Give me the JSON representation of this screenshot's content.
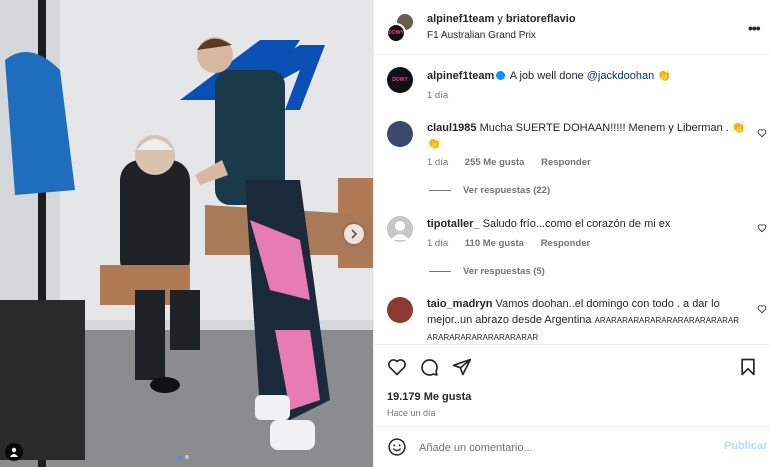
{
  "post": {
    "header": {
      "author": "alpinef1team",
      "connector": "y",
      "collaborator": "briatoreflavio",
      "location": "F1 Australian Grand Prix",
      "avatar_text": "DOWY"
    },
    "caption": {
      "username": "alpinef1team",
      "text": "A job well done",
      "mention": "@jackdoohan",
      "emoji": "👏",
      "time": "1 día"
    },
    "comments": [
      {
        "username": "claul1985",
        "text": "Mucha SUERTE DOHAAN!!!!! Menem y Liberman .",
        "emoji": "👏",
        "emoji2": "👏",
        "time": "1 día",
        "likes": "255 Me gusta",
        "reply": "Responder",
        "view_replies": "Ver respuestas (22)"
      },
      {
        "username": "tipotaller_",
        "text": "Saludo frío...como el corazón de mi ex",
        "time": "1 día",
        "likes": "110 Me gusta",
        "reply": "Responder",
        "view_replies": "Ver respuestas (5)"
      },
      {
        "username": "taio_madryn",
        "text": "Vamos doohan..el domingo con todo . a dar lo mejor..un abrazo desde Argentina",
        "text_caps": "ARARARARARARARARARARARARAR ARARARARARARARARARAR"
      }
    ],
    "likes": "19.179 Me gusta",
    "posted": "Hace un día",
    "comment_placeholder": "Añade un comentario...",
    "publish_label": "Publicar",
    "more_icon": "•••"
  },
  "photo": {
    "carousel_count": 2,
    "active_index": 0
  },
  "colors": {
    "link": "#00376b",
    "verified": "#0095f6",
    "publish_disabled": "#b3dbff",
    "meta": "#737373"
  }
}
